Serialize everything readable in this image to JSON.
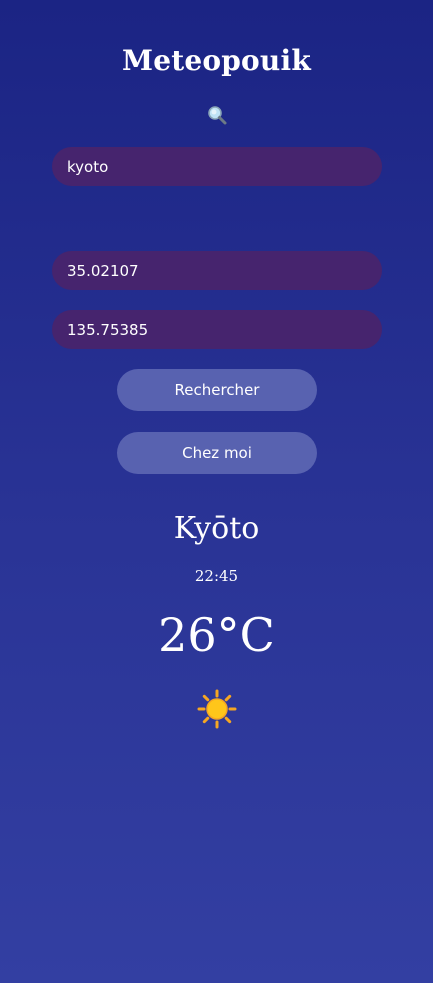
{
  "app": {
    "title": "Meteopouik"
  },
  "search": {
    "icon": "search-icon",
    "city_value": "kyoto",
    "latitude_value": "35.02107",
    "longitude_value": "135.75385",
    "search_button_label": "Rechercher",
    "home_button_label": "Chez moi"
  },
  "weather": {
    "city": "Kyōto",
    "time": "22:45",
    "temperature": "26°C",
    "icon": "sun-icon"
  },
  "colors": {
    "background_top": "#1b2484",
    "background_bottom": "#333fa2",
    "field_background": "#46246e",
    "button_background": "#5862b0",
    "sun": "#f5a623"
  }
}
